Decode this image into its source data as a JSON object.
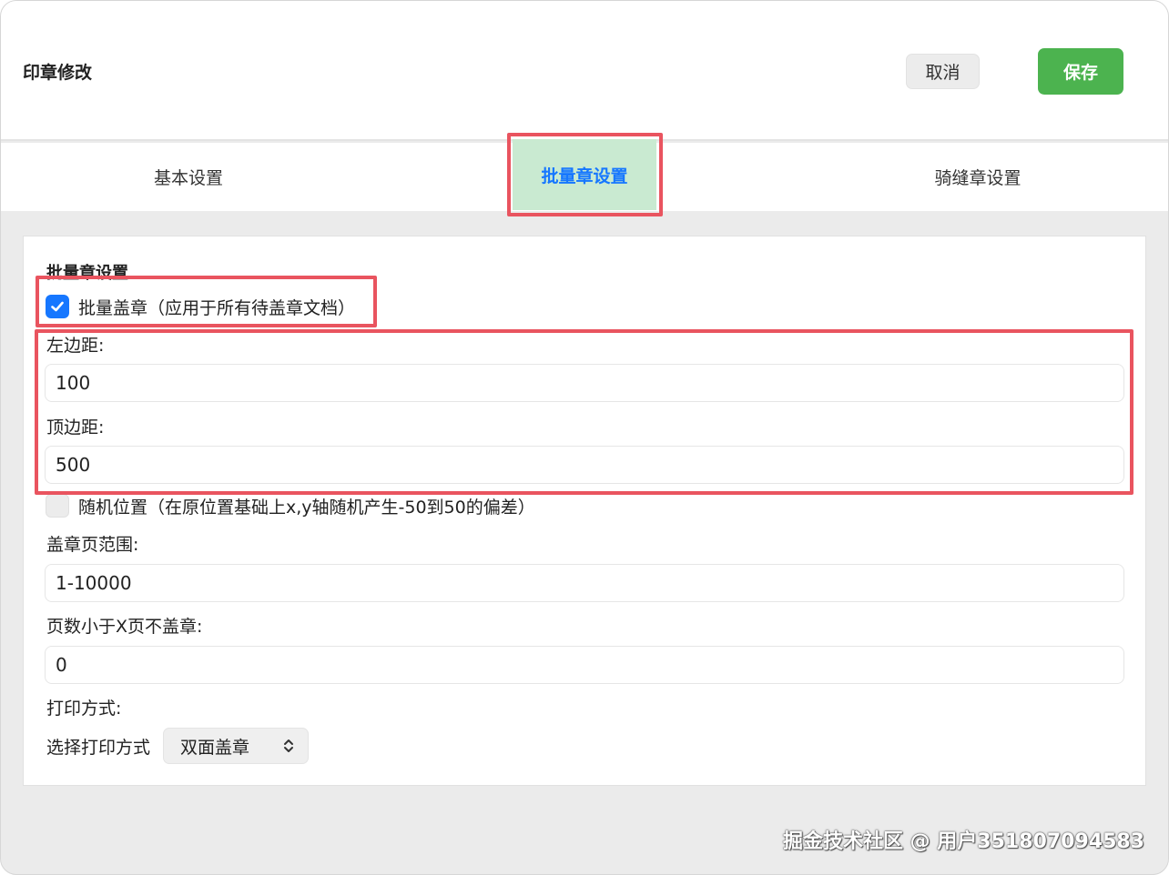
{
  "window": {
    "title": "印章修改"
  },
  "header": {
    "cancel_label": "取消",
    "save_label": "保存"
  },
  "tabs": [
    {
      "label": "基本设置"
    },
    {
      "label": "批量章设置"
    },
    {
      "label": "骑缝章设置"
    }
  ],
  "panel": {
    "section_title": "批量章设置",
    "batch_checkbox": {
      "label": "批量盖章（应用于所有待盖章文档）",
      "checked": true
    },
    "left_margin": {
      "label": "左边距:",
      "value": "100"
    },
    "top_margin": {
      "label": "顶边距:",
      "value": "500"
    },
    "random_checkbox": {
      "label": "随机位置（在原位置基础上x,y轴随机产生-50到50的偏差）",
      "checked": false
    },
    "page_range": {
      "label": "盖章页范围:",
      "value": "1-10000"
    },
    "min_pages": {
      "label": "页数小于X页不盖章:",
      "value": "0"
    },
    "print_mode": {
      "label": "打印方式:",
      "select_label": "选择打印方式",
      "selected": "双面盖章"
    }
  },
  "watermark": "掘金技术社区 @ 用户351807094583",
  "colors": {
    "accent_blue": "#1677ff",
    "save_green": "#4cb34f",
    "highlight_red": "#e9545f",
    "active_tab_bg": "#c9ead1"
  }
}
